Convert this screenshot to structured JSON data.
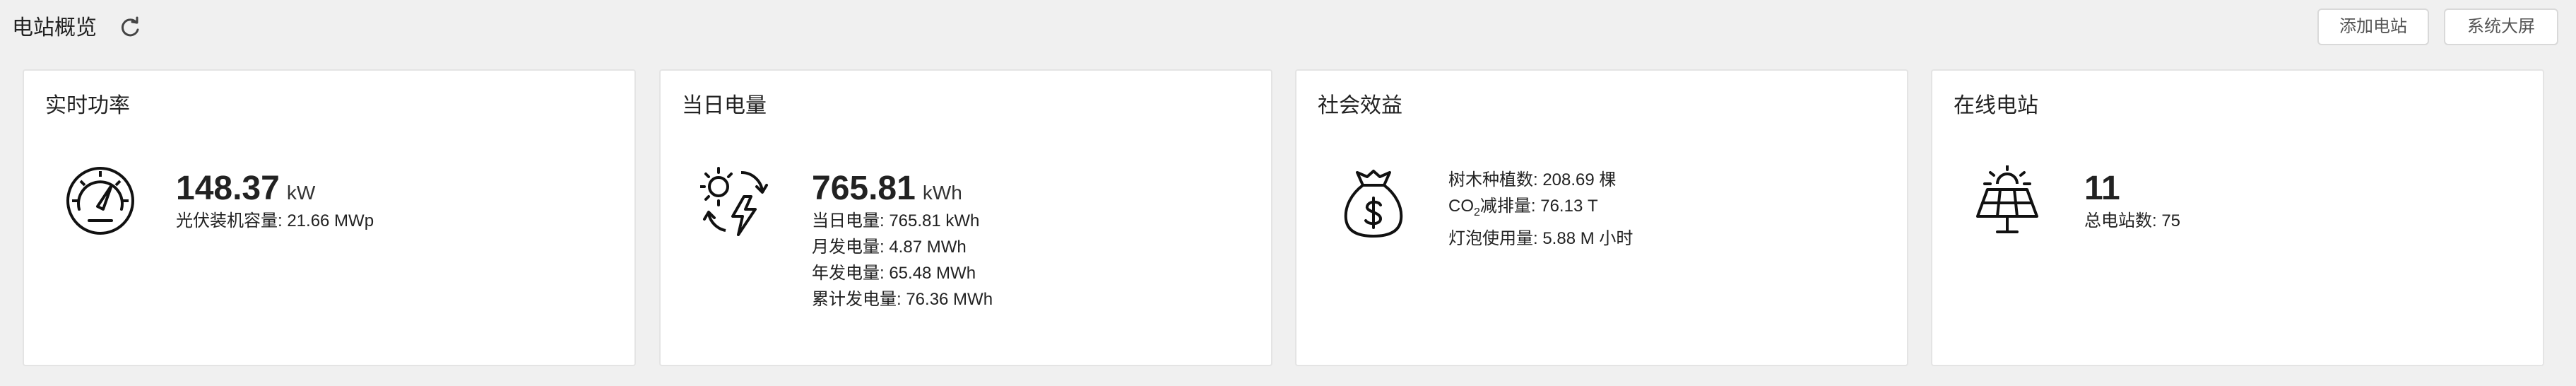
{
  "header": {
    "title": "电站概览",
    "add_station": "添加电站",
    "system_screen": "系统大屏"
  },
  "cards": {
    "realtime_power": {
      "title": "实时功率",
      "value": "148.37",
      "unit": "kW",
      "capacity": "光伏装机容量: 21.66 MWp",
      "icon": "gauge-icon"
    },
    "daily_energy": {
      "title": "当日电量",
      "value": "765.81",
      "unit": "kWh",
      "day": "当日电量: 765.81 kWh",
      "month": "月发电量: 4.87 MWh",
      "year": "年发电量: 65.48 MWh",
      "total": "累计发电量: 76.36 MWh",
      "icon": "sun-lightning-icon"
    },
    "social_benefit": {
      "title": "社会效益",
      "trees": "树木种植数: 208.69 棵",
      "co2_prefix": "CO",
      "co2_sub": "2",
      "co2_rest": "减排量: 76.13 T",
      "bulbs": "灯泡使用量: 5.88 M 小时",
      "icon": "money-bag-icon"
    },
    "online_stations": {
      "title": "在线电站",
      "value": "11",
      "total": "总电站数: 75",
      "icon": "solar-panel-icon"
    }
  }
}
